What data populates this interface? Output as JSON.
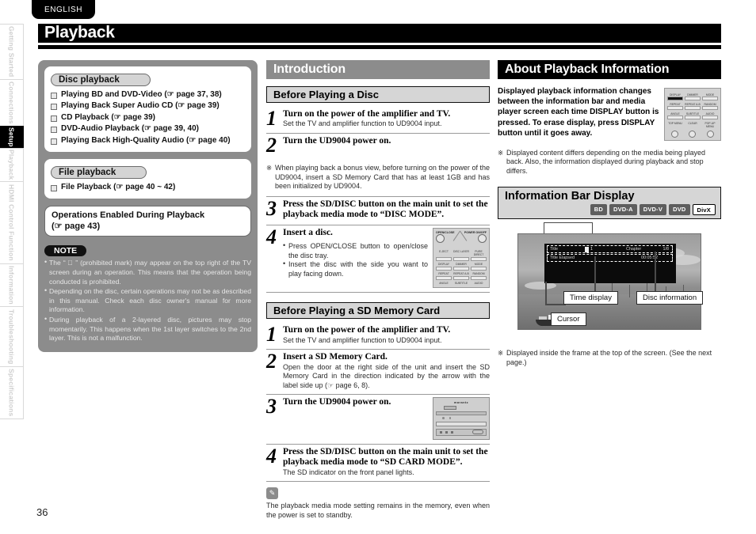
{
  "document": {
    "language_tab": "ENGLISH",
    "page_title": "Playback",
    "page_number": "36"
  },
  "side_rail": {
    "tabs": [
      {
        "label": "Getting Started",
        "active": false
      },
      {
        "label": "Connections",
        "active": false
      },
      {
        "label": "Setup",
        "active": true
      },
      {
        "label": "Playback",
        "active": false
      },
      {
        "label": "HDMI Control Function",
        "active": false
      },
      {
        "label": "Information",
        "active": false
      },
      {
        "label": "Troubleshooting",
        "active": false
      },
      {
        "label": "Specifications",
        "active": false
      }
    ]
  },
  "left_column": {
    "disc_playback": {
      "heading": "Disc playback",
      "items": [
        "Playing BD and DVD-Video (☞ page 37, 38)",
        "Playing Back Super Audio CD (☞ page 39)",
        "CD Playback (☞ page 39)",
        "DVD-Audio Playback (☞ page 39, 40)",
        "Playing Back High-Quality Audio (☞ page 40)"
      ]
    },
    "file_playback": {
      "heading": "File playback",
      "items": [
        "File Playback (☞ page 40 ~ 42)"
      ]
    },
    "operations_box": {
      "line1": "Operations Enabled During Playback",
      "line2": "(☞ page 43)"
    },
    "note": {
      "label": "NOTE",
      "items": [
        "The “ ⃠ ” (prohibited mark) may appear on the top right of the TV screen during an operation. This means that the operation being conducted is prohibited.",
        "Depending on the disc, certain operations may not be as described in this manual. Check each disc owner's manual for more information.",
        "During playback of a 2-layered disc, pictures may stop momentarily. This happens when the 1st layer switches to the 2nd layer. This is not a malfunction."
      ]
    }
  },
  "middle_column": {
    "section_title": "Introduction",
    "disc_section": {
      "heading": "Before Playing a Disc",
      "steps": [
        {
          "num": "1",
          "title": "Turn on the power of the amplifier and TV.",
          "sub": "Set the TV and amplifier function to UD9004 input."
        },
        {
          "num": "2",
          "title": "Turn the UD9004 power on.",
          "sub": ""
        },
        {
          "num": "3",
          "title": "Press the SD/DISC button on the main unit to set the playback media mode to “DISC MODE”.",
          "sub": ""
        },
        {
          "num": "4",
          "title": "Insert a disc.",
          "sub": ""
        }
      ],
      "asterisk_note": "When playing back a bonus view, before turning on the power of the UD9004, insert a SD Memory Card that has at least 1GB and has been initialized by UD9004.",
      "step4_bullets": [
        "Press OPEN/CLOSE button to open/close the disc tray.",
        "Insert the disc with the side you want to play facing down."
      ]
    },
    "sd_section": {
      "heading": "Before Playing a SD Memory Card",
      "steps": [
        {
          "num": "1",
          "title": "Turn on the power of the amplifier and TV.",
          "sub": "Set the TV and amplifier function to UD9004 input."
        },
        {
          "num": "2",
          "title": "Insert a SD Memory Card.",
          "sub": "Open the door at the right side of the unit and insert the SD Memory Card in the direction indicated by the arrow with the label side up (☞ page 6, 8)."
        },
        {
          "num": "3",
          "title": "Turn the UD9004 power on.",
          "sub": ""
        },
        {
          "num": "4",
          "title": "Press the SD/DISC button on the main unit to set the playback media mode to “SD CARD MODE”.",
          "sub": "The SD indicator on the front panel lights."
        }
      ]
    },
    "pencil_note": "The playback media mode setting remains in the memory, even when the power is set to standby."
  },
  "right_column": {
    "section_title": "About Playback Information",
    "intro_paragraph": "Displayed playback information changes between the information bar and media player screen each time DISPLAY button is pressed. To erase display, press DISPLAY button until it goes away.",
    "asterisk_note": "Displayed content differs depending on the media being played back. Also, the information displayed during playback and stop differs.",
    "info_bar": {
      "heading": "Information Bar Display",
      "badges": [
        {
          "label": "BD",
          "style": "solid"
        },
        {
          "label": "DVD-A",
          "style": "solid"
        },
        {
          "label": "DVD-V",
          "style": "solid"
        },
        {
          "label": "DVD",
          "style": "solid"
        },
        {
          "label": "DivX",
          "style": "outline"
        }
      ],
      "screen": {
        "row1_label": "Title",
        "row1_value": "1",
        "row1_right_label": "Chapter",
        "row1_right_value": "1/8",
        "row2_label": "Title Elapsed",
        "row2_value": "00:05:52"
      },
      "callouts": {
        "time_display": "Time display",
        "disc_information": "Disc information",
        "cursor": "Cursor"
      }
    },
    "footer_note": "Displayed inside the frame at the top of the screen. (See the next page.)"
  },
  "remote_labels": {
    "open_close": "OPEN/CLOSE",
    "power": "POWER ON/OFF",
    "row_a": [
      "E-JECT",
      "DISC LAYER",
      "PURE DIRECT"
    ],
    "row_b": [
      "DISPLAY",
      "DIMMER",
      "MODE"
    ],
    "row_c": [
      "REPEAT",
      "REPEAT A-B",
      "RANDOM"
    ],
    "row_d": [
      "ANGLE",
      "SUBTITLE",
      "AUDIO"
    ],
    "row_e": [
      "TOP MENU",
      "CLEAR",
      "POP-UP MENU"
    ],
    "brand": "marantz"
  },
  "colors": {
    "title_bar": "#000000",
    "section_gray": "#8c8c8c",
    "subhead_gray": "#d6d6d6",
    "badge_gray": "#5e5e5e"
  }
}
